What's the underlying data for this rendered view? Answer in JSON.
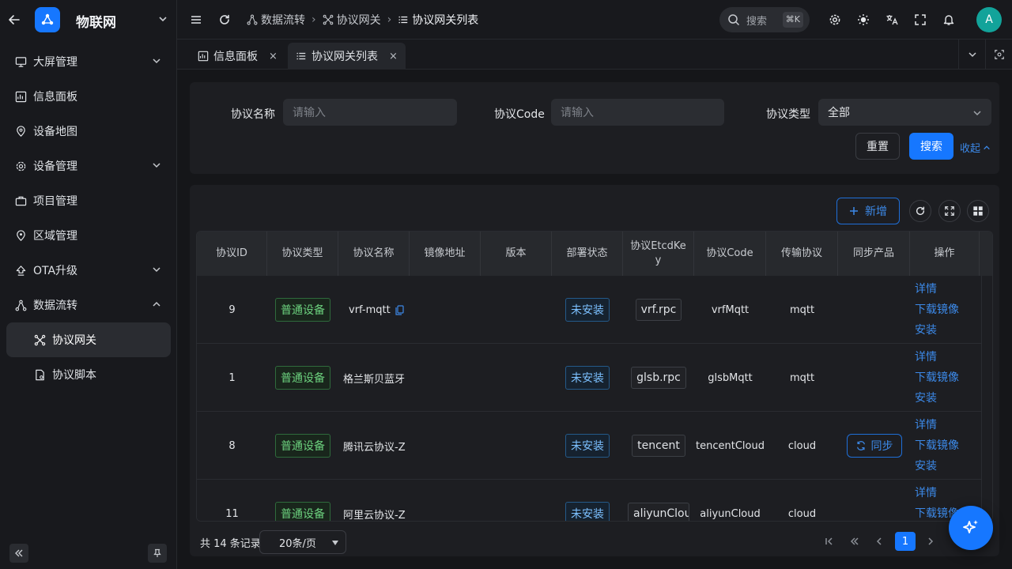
{
  "app": {
    "name": "物联网"
  },
  "sidebar": {
    "items": [
      {
        "label": "大屏管理",
        "icon": "monitor-icon"
      },
      {
        "label": "信息面板",
        "icon": "dashboard-icon"
      },
      {
        "label": "设备地图",
        "icon": "map-icon"
      },
      {
        "label": "设备管理",
        "icon": "cog-icon"
      },
      {
        "label": "项目管理",
        "icon": "briefcase-icon"
      },
      {
        "label": "区域管理",
        "icon": "location-icon"
      },
      {
        "label": "OTA升级",
        "icon": "upload-icon"
      },
      {
        "label": "数据流转",
        "icon": "flow-icon"
      },
      {
        "label": "协议网关",
        "icon": "gateway-icon"
      },
      {
        "label": "协议脚本",
        "icon": "script-icon"
      }
    ]
  },
  "breadcrumb": {
    "items": [
      "数据流转",
      "协议网关",
      "协议网关列表"
    ]
  },
  "header": {
    "search_label": "搜索",
    "search_shortcut": "⌘K",
    "avatar": "A"
  },
  "tabs": [
    {
      "label": "信息面板",
      "close": "×"
    },
    {
      "label": "协议网关列表",
      "close": "×"
    }
  ],
  "filters": {
    "name_label": "协议名称",
    "name_placeholder": "请输入",
    "code_label": "协议Code",
    "code_placeholder": "请输入",
    "type_label": "协议类型",
    "type_value": "全部",
    "reset": "重置",
    "search": "搜索",
    "collapse": "收起"
  },
  "toolbar": {
    "add": "新增"
  },
  "table": {
    "headers": [
      "协议ID",
      "协议类型",
      "协议名称",
      "镜像地址",
      "版本",
      "部署状态",
      "协议EtcdKey",
      "协议Code",
      "传输协议",
      "同步产品",
      "操作"
    ],
    "rows": [
      {
        "id": "9",
        "type": "普通设备",
        "name": "vrf-mqtt",
        "image": "",
        "version": "",
        "status": "未安装",
        "etcd": "vrf.rpc",
        "code": "vrfMqtt",
        "transport": "mqtt",
        "sync": ""
      },
      {
        "id": "1",
        "type": "普通设备",
        "name": "格兰斯贝蓝牙",
        "image": "",
        "version": "",
        "status": "未安装",
        "etcd": "glsb.rpc",
        "code": "glsbMqtt",
        "transport": "mqtt",
        "sync": ""
      },
      {
        "id": "8",
        "type": "普通设备",
        "name": "腾讯云协议-Z",
        "image": "",
        "version": "",
        "status": "未安装",
        "etcd": "tencent",
        "code": "tencentCloud",
        "transport": "cloud",
        "sync": "同步"
      },
      {
        "id": "11",
        "type": "普通设备",
        "name": "阿里云协议-Z",
        "image": "",
        "version": "",
        "status": "未安装",
        "etcd": "aliyunCloud",
        "code": "aliyunCloud",
        "transport": "cloud",
        "sync": ""
      }
    ],
    "ops": [
      "详情",
      "下载镜像",
      "安装"
    ]
  },
  "pagination": {
    "total": "共 14 条记录",
    "page_size": "20条/页",
    "current": "1"
  },
  "colors": {
    "accent": "#1677ff",
    "tag_green": "#6cd17e",
    "tag_blue": "#7cc0ff",
    "link": "#3c89e8"
  }
}
